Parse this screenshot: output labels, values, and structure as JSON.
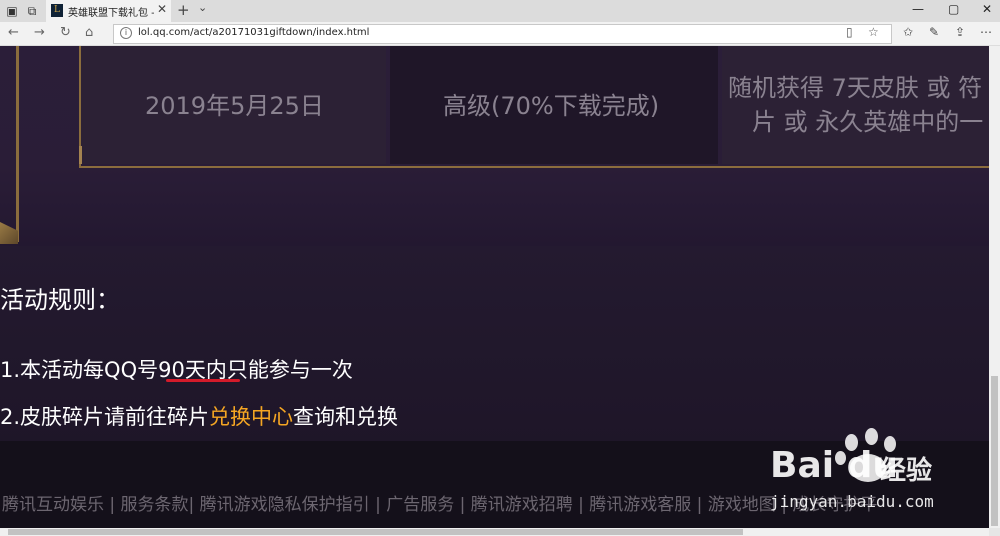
{
  "browser": {
    "tab_title": "英雄联盟下载礼包 - 英雄",
    "url": "lol.qq.com/act/a20171031giftdown/index.html",
    "icons": {
      "tab_set_aside": "window-stack-icon",
      "tab_restore": "tab-restore-icon",
      "new_tab": "+",
      "tab_list": "chevron-down-icon",
      "back": "←",
      "forward": "→",
      "refresh": "↻",
      "home": "⌂",
      "minimize": "—",
      "maximize": "▢",
      "close": "✕"
    }
  },
  "table": {
    "date": "2019年5月25日",
    "level": "高级(70%下载完成)",
    "reward_line1": "随机获得 7天皮肤 或 符",
    "reward_line2": "片 或 永久英雄中的一"
  },
  "rules": {
    "title": "活动规则：",
    "rule1_prefix": "1.本活动每QQ号",
    "rule1_highlight": "90天内",
    "rule1_suffix": "只能参与一次",
    "rule2_prefix": "2.皮肤碎片请前往碎片",
    "rule2_link": "兑换中心",
    "rule2_suffix": "查询和兑换"
  },
  "footer": {
    "text": "腾讯互动娱乐 | 服务条款| 腾讯游戏隐私保护指引 | 广告服务 | 腾讯游戏招聘 | 腾讯游戏客服 | 游戏地图 | 成长守护平"
  },
  "watermark": {
    "logo": "Bai du",
    "cn": "经验",
    "url": "jingyan.baidu.com"
  },
  "colors": {
    "accent_gold": "#8b6d3d",
    "link_orange": "#f5a623",
    "underline_red": "#d41b2a"
  }
}
